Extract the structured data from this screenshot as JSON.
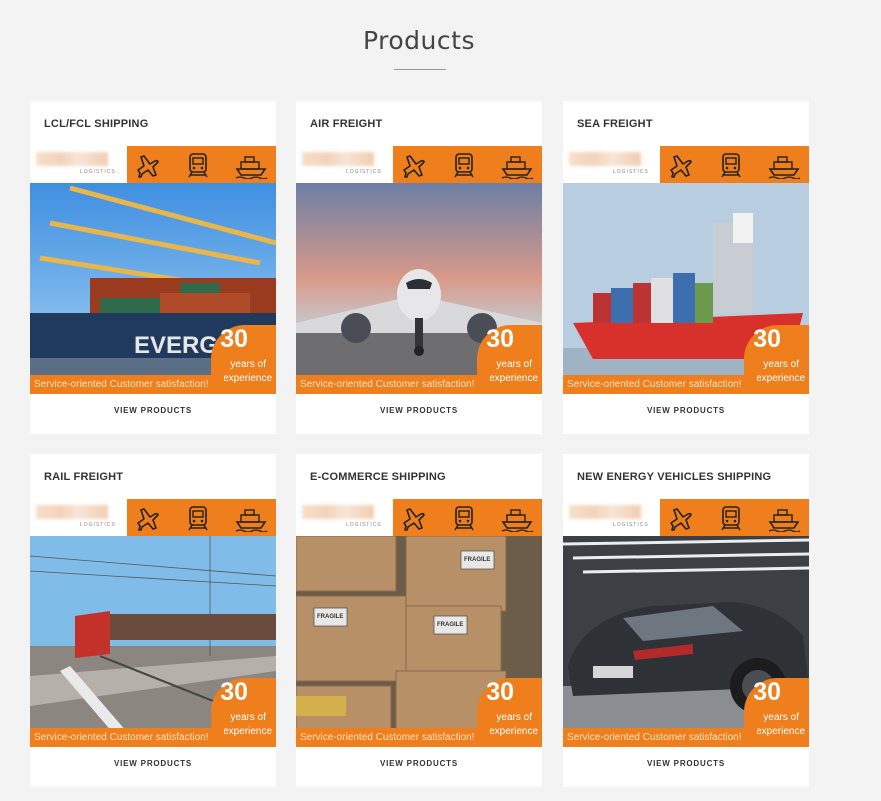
{
  "section_title": "Products",
  "accent_color": "#ee7f1c",
  "transport_icons": [
    "airplane-icon",
    "train-icon",
    "ship-icon"
  ],
  "logo_caption": "LOGISTICS",
  "badge": {
    "number": "30",
    "line1": "years of",
    "line2": "experience"
  },
  "tagline": "Service-oriented Customer satisfaction!",
  "cards": [
    {
      "title": "LCL/FCL SHIPPING",
      "image": "container-ship-photo",
      "cta": "VIEW PRODUCTS"
    },
    {
      "title": "AIR FREIGHT",
      "image": "airplane-photo",
      "cta": "VIEW PRODUCTS"
    },
    {
      "title": "SEA FREIGHT",
      "image": "cargo-ship-photo",
      "cta": "VIEW PRODUCTS"
    },
    {
      "title": "RAIL FREIGHT",
      "image": "freight-train-photo",
      "cta": "VIEW PRODUCTS"
    },
    {
      "title": "E-COMMERCE SHIPPING",
      "image": "cardboard-boxes-photo",
      "cta": "VIEW PRODUCTS"
    },
    {
      "title": "NEW ENERGY VEHICLES SHIPPING",
      "image": "sports-car-photo",
      "cta": "VIEW PRODUCTS"
    }
  ]
}
